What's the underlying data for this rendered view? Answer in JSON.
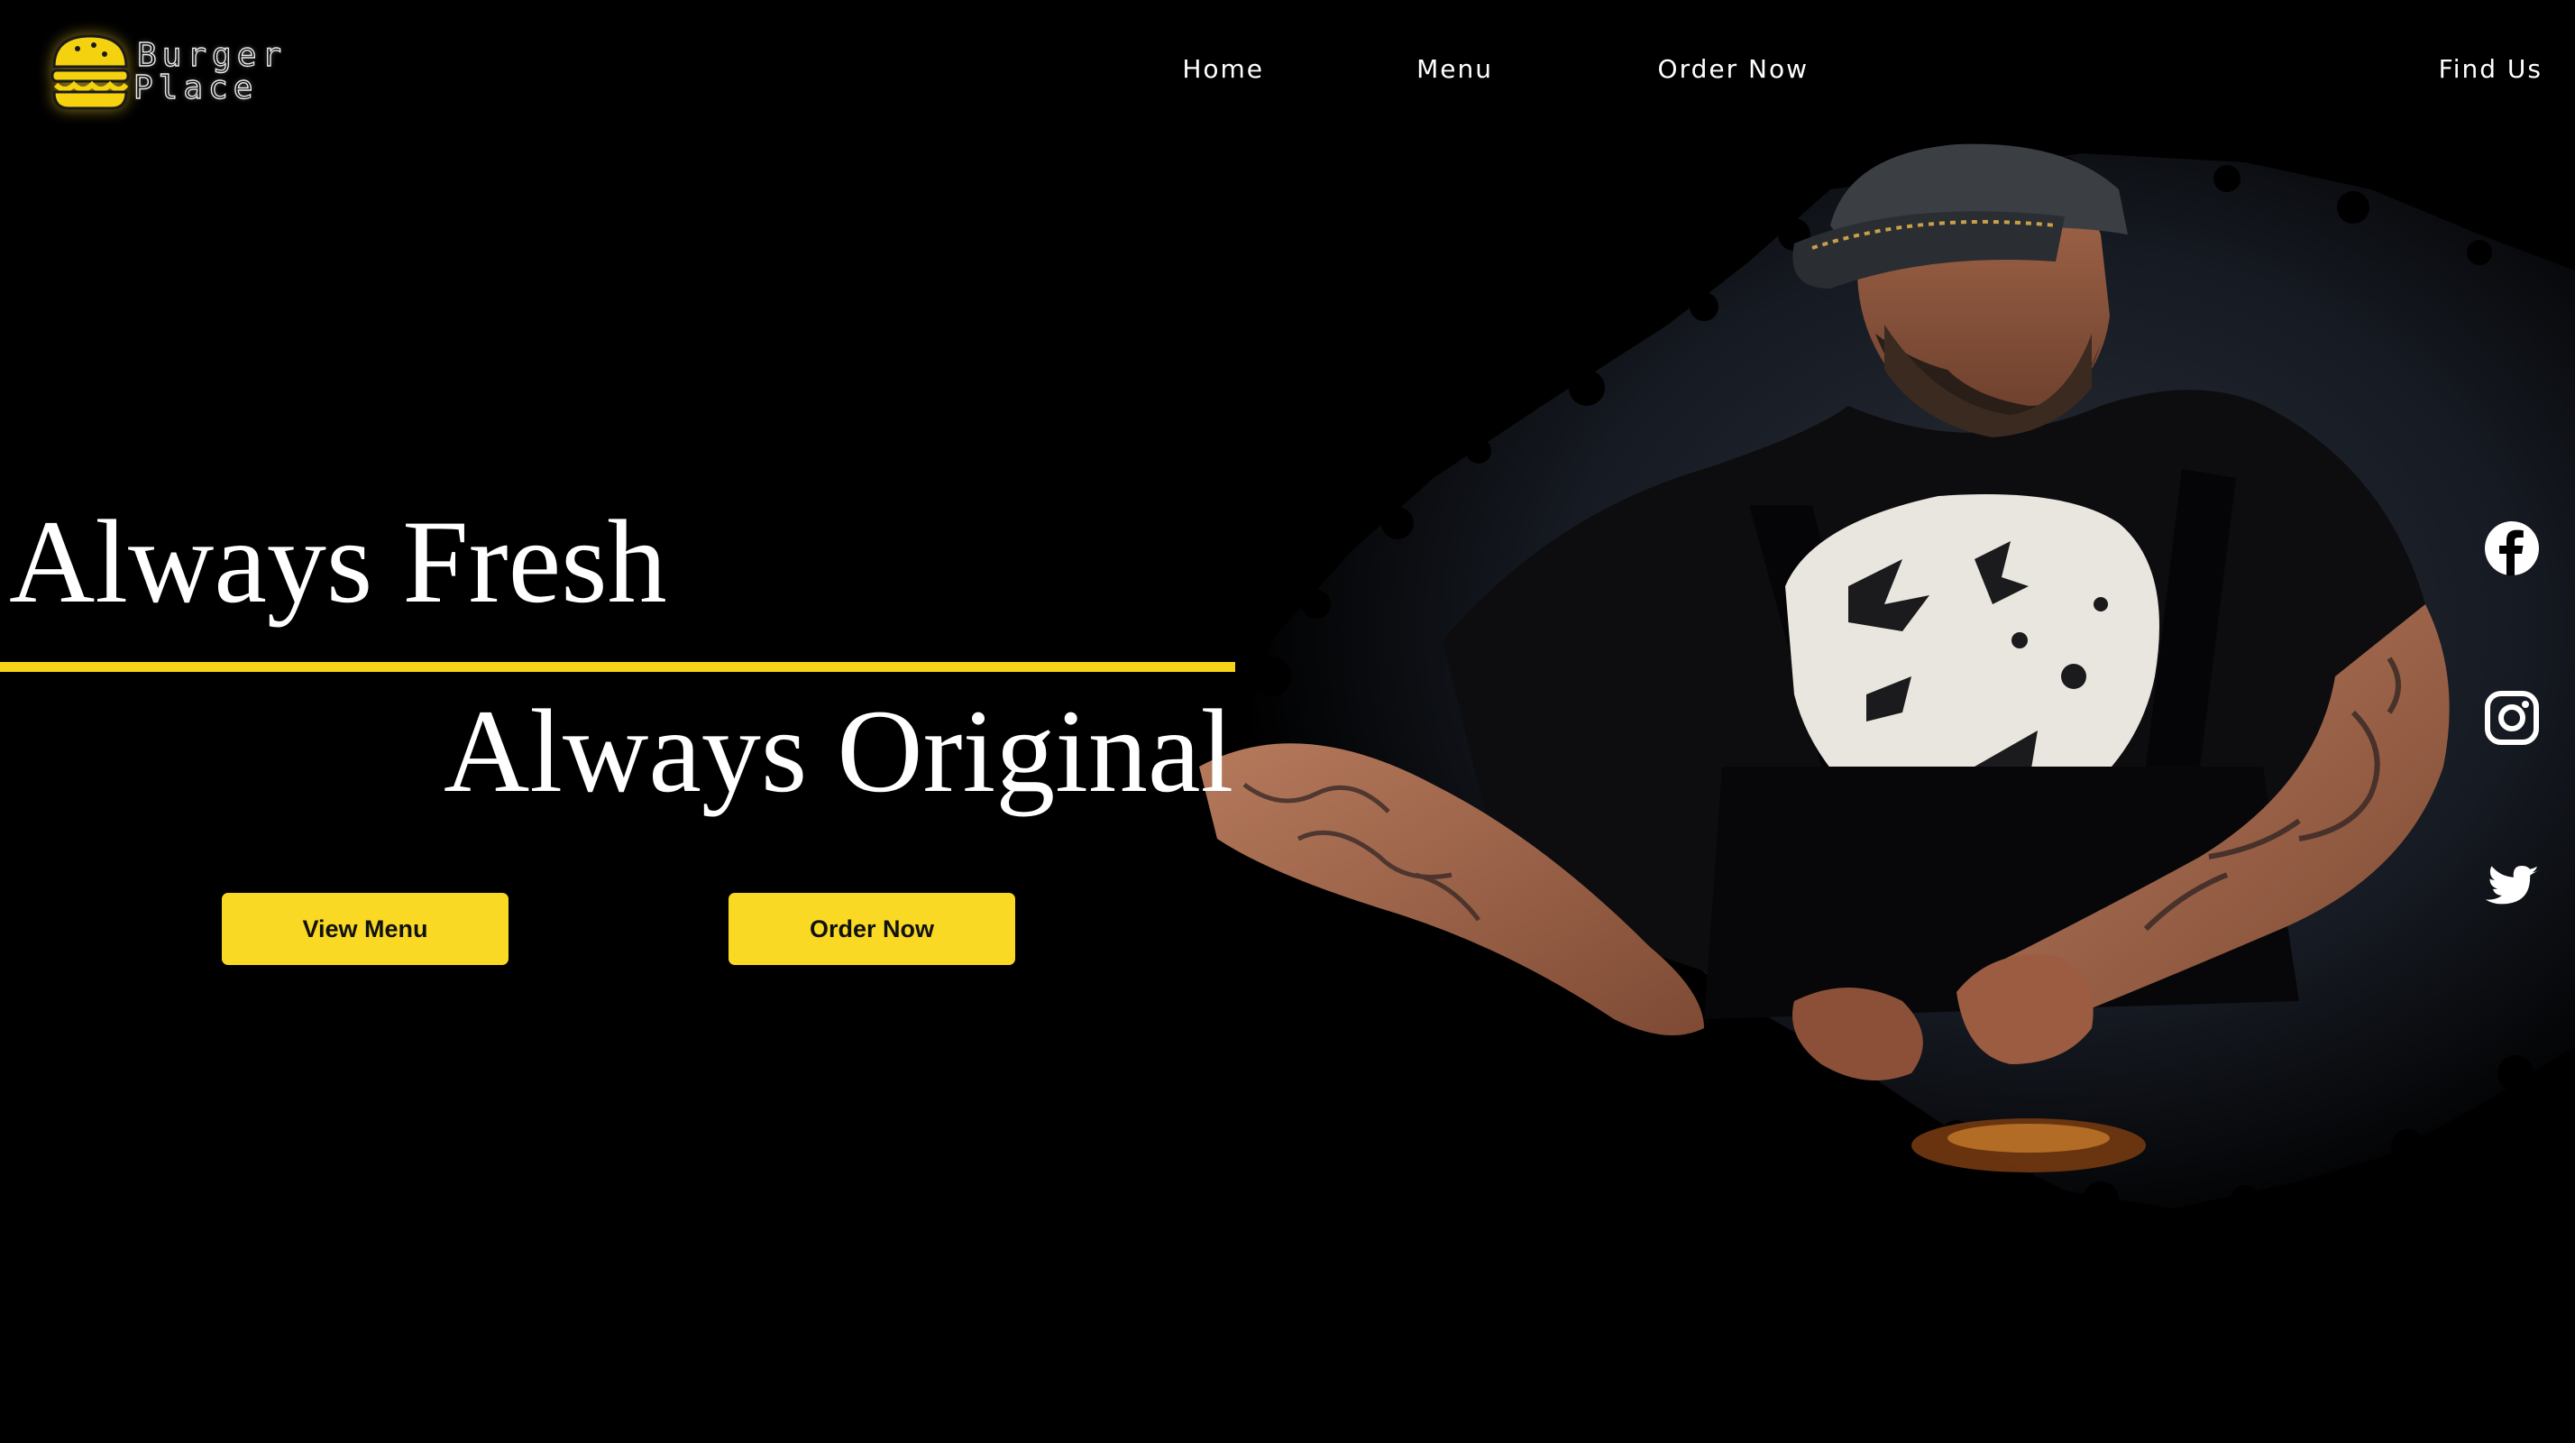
{
  "brand": {
    "name_line1": "Burger",
    "name_line2": "Place",
    "logo_icon": "burger-icon",
    "accent_color": "#f9d923"
  },
  "nav": {
    "items": [
      {
        "label": "Home"
      },
      {
        "label": "Menu"
      },
      {
        "label": "Order Now"
      },
      {
        "label": "Find Us"
      }
    ]
  },
  "hero": {
    "headline_1": "Always Fresh",
    "headline_2": "Always Original",
    "image": "chef-cooking-photo",
    "buttons": {
      "view_menu": "View Menu",
      "order_now": "Order Now"
    }
  },
  "social": {
    "items": [
      {
        "icon": "facebook-icon"
      },
      {
        "icon": "instagram-icon"
      },
      {
        "icon": "twitter-icon"
      }
    ]
  }
}
